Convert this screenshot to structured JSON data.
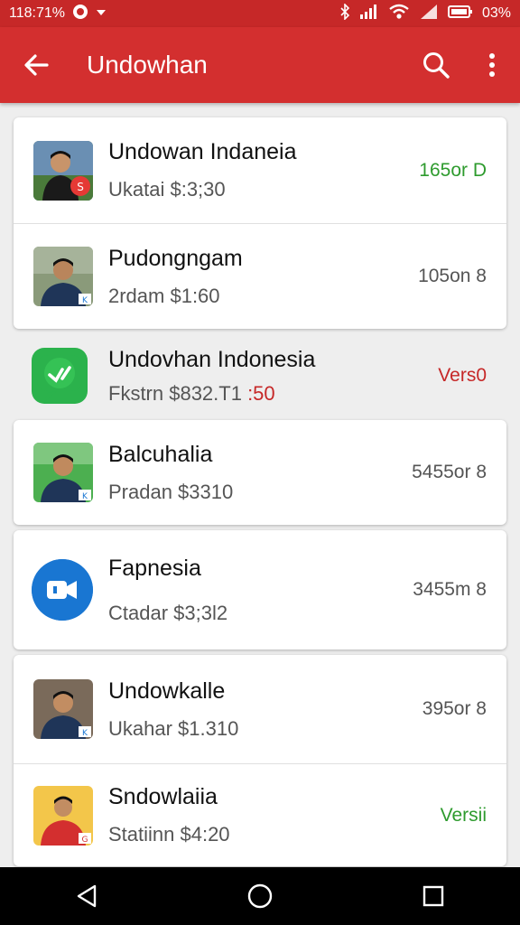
{
  "status_bar": {
    "time": "1­18:71%",
    "battery": "03%"
  },
  "app_bar": {
    "title": "Undowhan"
  },
  "items": [
    {
      "name": "Undowan Indaneia",
      "sub": "Ukatai $:3;30",
      "meta": "165or D",
      "meta_color": "green",
      "avatar": "person-red"
    },
    {
      "name": "Pudongngam",
      "sub": "2rdam $1:60",
      "meta": "105on 8",
      "meta_color": "gray",
      "avatar": "person-navy"
    },
    {
      "name": "Undovhan Indonesia",
      "sub": "Fkstrn $832.T1",
      "sub_highlight": " :50",
      "meta": "Vers0",
      "meta_color": "red",
      "avatar": "app-green"
    },
    {
      "name": "Balcuhalia",
      "sub": "Pradan $3310",
      "meta": "5455or 8",
      "meta_color": "gray",
      "avatar": "person-navy2"
    },
    {
      "name": "Fapnesia",
      "sub": "Ctadar $3;3l2",
      "meta": "3455m 8",
      "meta_color": "gray",
      "avatar": "app-blue"
    },
    {
      "name": "Undowkalle",
      "sub": "Ukahar $1.310",
      "meta": "395or 8",
      "meta_color": "gray",
      "avatar": "person-navy3"
    },
    {
      "name": "Sndowlaiia",
      "sub": "Statiinn $4:20",
      "meta": "Versii",
      "meta_color": "green",
      "avatar": "person-red2"
    }
  ],
  "colors": {
    "primary": "#d32f2f",
    "status": "#c62828",
    "green": "#2e9b2e",
    "blue": "#1976d2",
    "appgreen": "#2bb24c"
  }
}
